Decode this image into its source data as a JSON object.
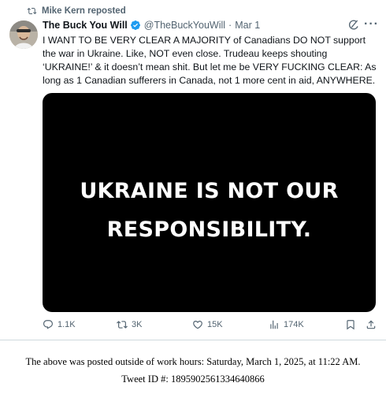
{
  "repost": {
    "label": "Mike Kern reposted"
  },
  "author": {
    "name": "The Buck You Will",
    "handle": "@TheBuckYouWill",
    "separator": "·",
    "date": "Mar 1"
  },
  "tweet": {
    "text": "I WANT TO BE VERY CLEAR A MAJORITY of Canadians DO NOT support the war in Ukraine. Like, NOT even close. Trudeau keeps shouting ‘UKRAINE!’ & it doesn’t mean shit. But let me be VERY FUCKING CLEAR: As long as 1 Canadian sufferers in Canada, not 1 more cent in aid, ANYWHERE.",
    "media_line1": "UKRAINE IS NOT OUR",
    "media_line2": "RESPONSIBILITY.",
    "more_glyph": "···"
  },
  "actions": {
    "replies": "1.1K",
    "reposts": "3K",
    "likes": "15K",
    "views": "174K"
  },
  "footer": {
    "line1": "The above was posted outside of work hours: Saturday, March 1, 2025, at 11:22 AM.",
    "line2": "Tweet ID #: 1895902561334640866"
  },
  "colors": {
    "text": "#0f1419",
    "muted": "#536471",
    "verified": "#1d9bf0",
    "media_bg": "#000000"
  }
}
